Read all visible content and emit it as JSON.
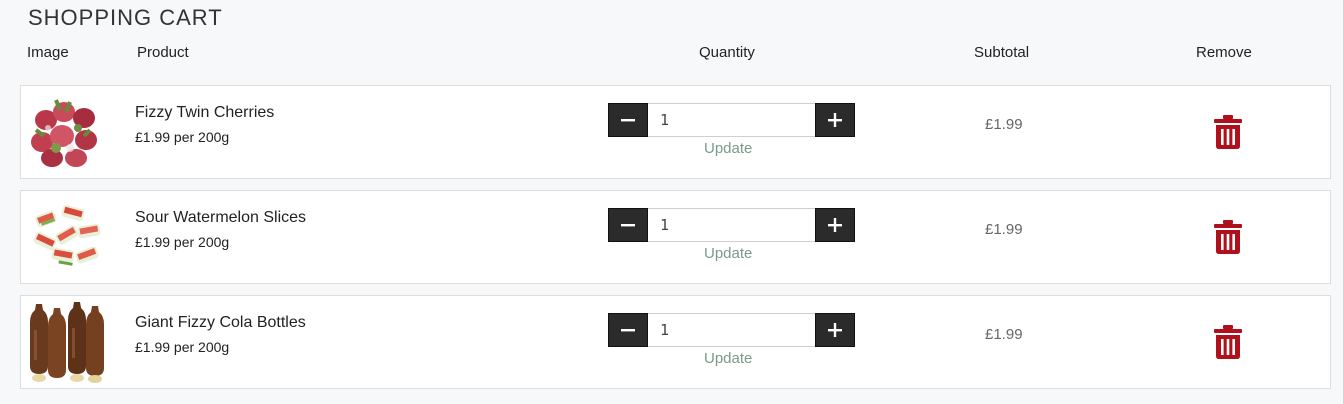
{
  "page": {
    "title": "SHOPPING CART"
  },
  "columns": {
    "image": "Image",
    "product": "Product",
    "quantity": "Quantity",
    "subtotal": "Subtotal",
    "remove": "Remove"
  },
  "items": [
    {
      "name": "Fizzy Twin Cherries",
      "price": "£1.99 per 200g",
      "quantity": "1",
      "update_label": "Update",
      "subtotal": "£1.99",
      "image_icon": "cherries-image"
    },
    {
      "name": "Sour Watermelon Slices",
      "price": "£1.99 per 200g",
      "quantity": "1",
      "update_label": "Update",
      "subtotal": "£1.99",
      "image_icon": "watermelon-image"
    },
    {
      "name": "Giant Fizzy Cola Bottles",
      "price": "£1.99 per 200g",
      "quantity": "1",
      "update_label": "Update",
      "subtotal": "£1.99",
      "image_icon": "cola-bottles-image"
    }
  ],
  "colors": {
    "trash": "#b0101c",
    "qty_button": "#2b2b2b",
    "update_link": "#7a9a8a"
  }
}
